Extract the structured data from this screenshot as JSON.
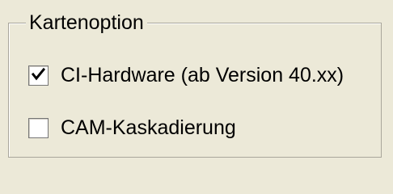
{
  "group": {
    "title": "Kartenoption",
    "options": [
      {
        "label": "CI-Hardware (ab Version 40.xx)",
        "checked": true
      },
      {
        "label": "CAM-Kaskadierung",
        "checked": false
      }
    ]
  },
  "icons": {
    "checkmark": "check-icon"
  },
  "colors": {
    "background": "#ece9d8",
    "border": "#a9a69b",
    "checkbox_background": "#ffffff",
    "text": "#000000"
  }
}
